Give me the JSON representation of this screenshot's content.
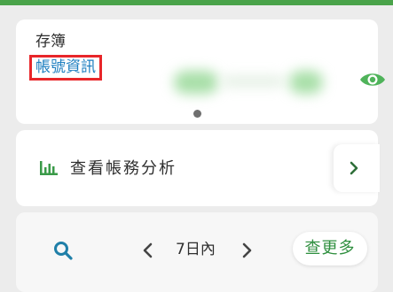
{
  "passbook": {
    "title": "存簿",
    "account_link": "帳號資訊",
    "eye_icon": "eye-icon"
  },
  "analysis": {
    "label": "查看帳務分析",
    "chart_icon": "bar-chart-icon",
    "arrow_icon": "chevron-right-icon"
  },
  "filter": {
    "search_icon": "search-icon",
    "prev_icon": "chevron-left-icon",
    "range_label": "7日內",
    "next_icon": "chevron-right-icon",
    "more_label": "查更多"
  },
  "colors": {
    "brand_green": "#4aa34a",
    "link_blue": "#1e7fc0",
    "highlight_red": "#e8262a",
    "background": "#ececec"
  }
}
